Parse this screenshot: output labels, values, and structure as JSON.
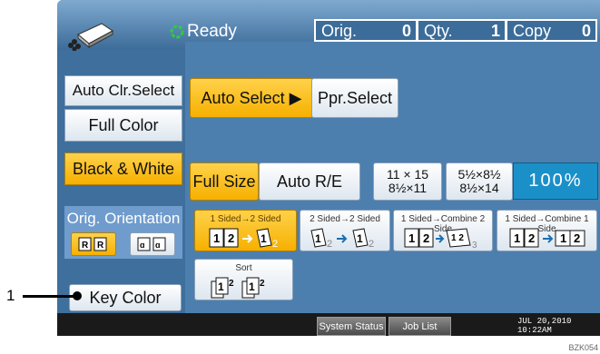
{
  "status": {
    "text": "Ready"
  },
  "counters": [
    {
      "label": "Orig.",
      "value": "0"
    },
    {
      "label": "Qty.",
      "value": "1"
    },
    {
      "label": "Copy",
      "value": "0"
    }
  ],
  "left": {
    "auto_clr": "Auto Clr.Select",
    "full_color": "Full Color",
    "black_white": "Black & White",
    "orig_orientation": "Orig. Orientation",
    "key_color": "Key Color"
  },
  "paper": {
    "auto_select": "Auto Select ▶",
    "ppr_select": "Ppr.Select"
  },
  "reduce": {
    "full_size": "Full Size",
    "auto_re": "Auto R/E",
    "r1_top": "11 × 15",
    "r1_bot": "8½×11",
    "r2_top": "5½×8½",
    "r2_bot": "8½×14",
    "percent": "100%"
  },
  "duplex": [
    {
      "label": "1 Sided→2 Sided"
    },
    {
      "label": "2 Sided→2 Sided"
    },
    {
      "label": "1 Sided→Combine 2 Side"
    },
    {
      "label": "1 Sided→Combine 1 Side"
    }
  ],
  "sort": {
    "label": "Sort"
  },
  "footer": {
    "system_status": "System Status",
    "job_list": "Job List",
    "date": "JUL  20,2010",
    "time": "10:22AM"
  },
  "callout": {
    "number": "1"
  },
  "figure_code": "BZK054",
  "colors": {
    "selected": "#f6b000",
    "screen_blue": "#3f6f9c",
    "percent_blue": "#1b90c8"
  }
}
